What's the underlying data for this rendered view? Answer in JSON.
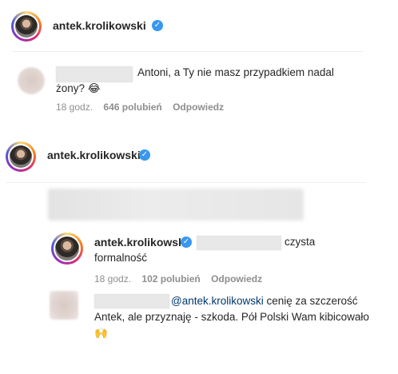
{
  "header": {
    "username": "antek.krolikowski",
    "verified_icon": "verified-badge-icon"
  },
  "comment1": {
    "text": "Antoni, a Ty nie masz przypadkiem nadal żony?",
    "emoji": "😂",
    "time": "18 godz.",
    "likes": "646 polubień",
    "reply": "Odpowiedz"
  },
  "header2": {
    "username": "antek.krolikowski"
  },
  "reply1": {
    "username": "antek.krolikowski",
    "text_after_mention": "czysta formalność",
    "time": "18 godz.",
    "likes": "102 polubień",
    "reply": "Odpowiedz"
  },
  "reply2": {
    "mention": "@antek.krolikowski",
    "text": "cenię za szczerość Antek, ale przyznaję - szkoda. Pół Polski Wam kibicowało",
    "emoji": "🙌"
  },
  "colors": {
    "verified": "#3897f0",
    "mention": "#00376b",
    "meta": "#8e8e8e"
  }
}
